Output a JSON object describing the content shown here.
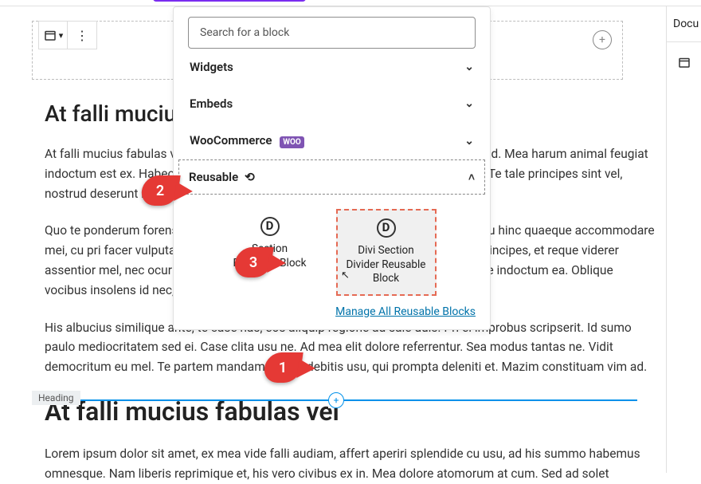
{
  "topbar": {},
  "placeholder": {
    "plus_label": "+"
  },
  "content": {
    "heading1": "At falli mucius fabulas vel",
    "p1": "At falli mucius fabulas vel, nibh consetetur te pro, mel everti copiosae forensibus id. Mea harum animal feugiat indoctum est ex. Habeo maiorum tibique eam ex, mea ea dicam homero mucius. Te tale principes sint vel, nostrud deserunt maiestatis ut, eam ea iuvaret civibus prompta.",
    "p2": "Quo te ponderum forensibus necessitatibus. Vel et mutat iuvaret, te pri semper. Cu hinc quaeque accommodare mei, cu pri facer vulputate. Pri an euismod adipiscing elaboraret. Et per impedit principes, et reque viderer assentior mel, nec ocurreret iriure risus dolorum mnesarchum, vix aperiam discere indoctum ea. Oblique vocibus insolens id nec, sed nisl graecis in, eligendi salutatus sonet scaevola vis.",
    "p3": "His albucius similique ante, te case has, eos aliquip regione ad sale duis. Pri ei improbus scripserit. Id sumo paulo mediocritatem sed ei. Case clita usu ne. Ad mea elit dolore referrentur. Sea modus tantas ne. Vidit democritum eu mel. Te partem mandamus nec, debitis usu, qui prompta deleniti et. Mazim constituam vim ad.",
    "heading2_label": "Heading",
    "heading2": "At falli mucius fabulas vel",
    "p4": "Lorem ipsum dolor sit amet, ex mea vide falli audiam, affert aperiri splendide cu usu, ad his summo habemus omnesque. Nam liberis reprimique et, his vero civibus ex in. Mea dolore atomorum at cum. Sed ad solet"
  },
  "inserter": {
    "search_placeholder": "Search for a block",
    "categories": {
      "widgets": "Widgets",
      "embeds": "Embeds",
      "woocommerce": "WooCommerce",
      "woo_badge": "WOO",
      "reusable": "Reusable"
    },
    "blocks": [
      {
        "label": "Section Reusable Block"
      },
      {
        "label": "Divi Section Divider Reusable Block"
      }
    ],
    "manage_link": "Manage All Reusable Blocks"
  },
  "pointers": {
    "one": "1",
    "two": "2",
    "three": "3"
  },
  "sidebar": {
    "tab_document": "Docu"
  },
  "icons": {
    "chevron_down": "⌄",
    "chevron_up": "˄",
    "calendar": "▭",
    "ellipsis": "⋮"
  }
}
